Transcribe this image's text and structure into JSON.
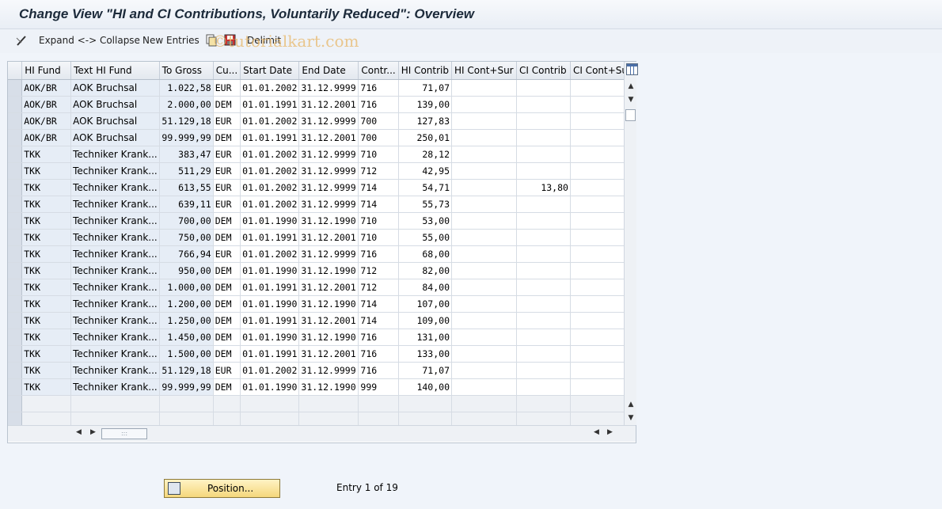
{
  "title": "Change View \"HI and CI Contributions, Voluntarily Reduced\": Overview",
  "toolbar": {
    "expand_label": "Expand <-> Collapse",
    "new_entries_label": "New Entries",
    "delimit_label": "Delimit"
  },
  "watermark": "©tutorialkart.com",
  "table": {
    "columns": [
      "HI Fund",
      "Text HI Fund",
      "To Gross",
      "Cu...",
      "Start Date",
      "End Date",
      "Contr...",
      "HI Contrib",
      "HI Cont+Sur",
      "CI Contrib",
      "CI Cont+Sur"
    ],
    "rows": [
      [
        "AOK/BR",
        "AOK Bruchsal",
        "1.022,58",
        "EUR",
        "01.01.2002",
        "31.12.9999",
        "716",
        "71,07",
        "",
        "",
        ""
      ],
      [
        "AOK/BR",
        "AOK Bruchsal",
        "2.000,00",
        "DEM",
        "01.01.1991",
        "31.12.2001",
        "716",
        "139,00",
        "",
        "",
        ""
      ],
      [
        "AOK/BR",
        "AOK Bruchsal",
        "51.129,18",
        "EUR",
        "01.01.2002",
        "31.12.9999",
        "700",
        "127,83",
        "",
        "",
        ""
      ],
      [
        "AOK/BR",
        "AOK Bruchsal",
        "99.999,99",
        "DEM",
        "01.01.1991",
        "31.12.2001",
        "700",
        "250,01",
        "",
        "",
        ""
      ],
      [
        "TKK",
        "Techniker Krank...",
        "383,47",
        "EUR",
        "01.01.2002",
        "31.12.9999",
        "710",
        "28,12",
        "",
        "",
        ""
      ],
      [
        "TKK",
        "Techniker Krank...",
        "511,29",
        "EUR",
        "01.01.2002",
        "31.12.9999",
        "712",
        "42,95",
        "",
        "",
        ""
      ],
      [
        "TKK",
        "Techniker Krank...",
        "613,55",
        "EUR",
        "01.01.2002",
        "31.12.9999",
        "714",
        "54,71",
        "",
        "13,80",
        ""
      ],
      [
        "TKK",
        "Techniker Krank...",
        "639,11",
        "EUR",
        "01.01.2002",
        "31.12.9999",
        "714",
        "55,73",
        "",
        "",
        ""
      ],
      [
        "TKK",
        "Techniker Krank...",
        "700,00",
        "DEM",
        "01.01.1990",
        "31.12.1990",
        "710",
        "53,00",
        "",
        "",
        ""
      ],
      [
        "TKK",
        "Techniker Krank...",
        "750,00",
        "DEM",
        "01.01.1991",
        "31.12.2001",
        "710",
        "55,00",
        "",
        "",
        ""
      ],
      [
        "TKK",
        "Techniker Krank...",
        "766,94",
        "EUR",
        "01.01.2002",
        "31.12.9999",
        "716",
        "68,00",
        "",
        "",
        ""
      ],
      [
        "TKK",
        "Techniker Krank...",
        "950,00",
        "DEM",
        "01.01.1990",
        "31.12.1990",
        "712",
        "82,00",
        "",
        "",
        ""
      ],
      [
        "TKK",
        "Techniker Krank...",
        "1.000,00",
        "DEM",
        "01.01.1991",
        "31.12.2001",
        "712",
        "84,00",
        "",
        "",
        ""
      ],
      [
        "TKK",
        "Techniker Krank...",
        "1.200,00",
        "DEM",
        "01.01.1990",
        "31.12.1990",
        "714",
        "107,00",
        "",
        "",
        ""
      ],
      [
        "TKK",
        "Techniker Krank...",
        "1.250,00",
        "DEM",
        "01.01.1991",
        "31.12.2001",
        "714",
        "109,00",
        "",
        "",
        ""
      ],
      [
        "TKK",
        "Techniker Krank...",
        "1.450,00",
        "DEM",
        "01.01.1990",
        "31.12.1990",
        "716",
        "131,00",
        "",
        "",
        ""
      ],
      [
        "TKK",
        "Techniker Krank...",
        "1.500,00",
        "DEM",
        "01.01.1991",
        "31.12.2001",
        "716",
        "133,00",
        "",
        "",
        ""
      ],
      [
        "TKK",
        "Techniker Krank...",
        "51.129,18",
        "EUR",
        "01.01.2002",
        "31.12.9999",
        "716",
        "71,07",
        "",
        "",
        ""
      ],
      [
        "TKK",
        "Techniker Krank...",
        "99.999,99",
        "DEM",
        "01.01.1990",
        "31.12.1990",
        "999",
        "140,00",
        "",
        "",
        ""
      ]
    ],
    "empty_rows": 2
  },
  "position_button_label": "Position...",
  "entry_info": "Entry 1 of 19",
  "icons": {
    "expand": "pencil-glasses-icon",
    "copy": "copy-icon",
    "save": "save-icon",
    "config": "table-settings-icon",
    "position": "position-icon"
  },
  "colors": {
    "key_column_bg": "#e6edf6",
    "button_bg": "#f5d77c",
    "title_color": "#1c2a3a"
  }
}
